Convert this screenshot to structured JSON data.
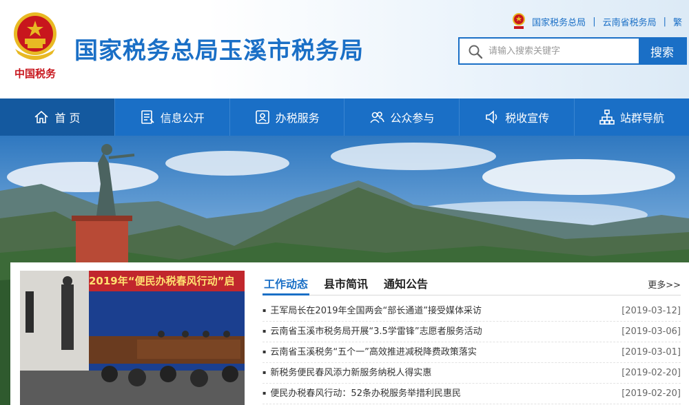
{
  "header": {
    "site_title": "国家税务总局玉溪市税务局",
    "emblem_caption": "中国税务",
    "top_links": [
      "国家税务总局",
      "云南省税务局",
      "繁"
    ],
    "search_placeholder": "请输入搜索关键字",
    "search_button": "搜索"
  },
  "nav": {
    "items": [
      {
        "label": "首 页",
        "icon": "home-icon"
      },
      {
        "label": "信息公开",
        "icon": "document-icon"
      },
      {
        "label": "办税服务",
        "icon": "user-id-icon"
      },
      {
        "label": "公众参与",
        "icon": "people-icon"
      },
      {
        "label": "税收宣传",
        "icon": "speaker-icon"
      },
      {
        "label": "站群导航",
        "icon": "sitemap-icon"
      }
    ]
  },
  "photo": {
    "banner_text": "2019年“便民办税春风行动”启"
  },
  "tabs": {
    "items": [
      "工作动态",
      "县市简讯",
      "通知公告"
    ],
    "more": "更多>>"
  },
  "news": [
    {
      "title": "王军局长在2019年全国两会“部长通道”接受媒体采访",
      "date": "[2019-03-12]"
    },
    {
      "title": "云南省玉溪市税务局开展“3.5学雷锋”志愿者服务活动",
      "date": "[2019-03-06]"
    },
    {
      "title": "云南省玉溪税务“五个一”高效推进减税降费政策落实",
      "date": "[2019-03-01]"
    },
    {
      "title": "新税务便民春风添力新服务纳税人得实惠",
      "date": "[2019-02-20]"
    },
    {
      "title": "便民办税春风行动：52条办税服务举措利民惠民",
      "date": "[2019-02-20]"
    }
  ],
  "colors": {
    "brand": "#1a6fc6",
    "nav_active": "#14599f",
    "emblem_red": "#c8161d",
    "emblem_gold": "#e8b923"
  }
}
